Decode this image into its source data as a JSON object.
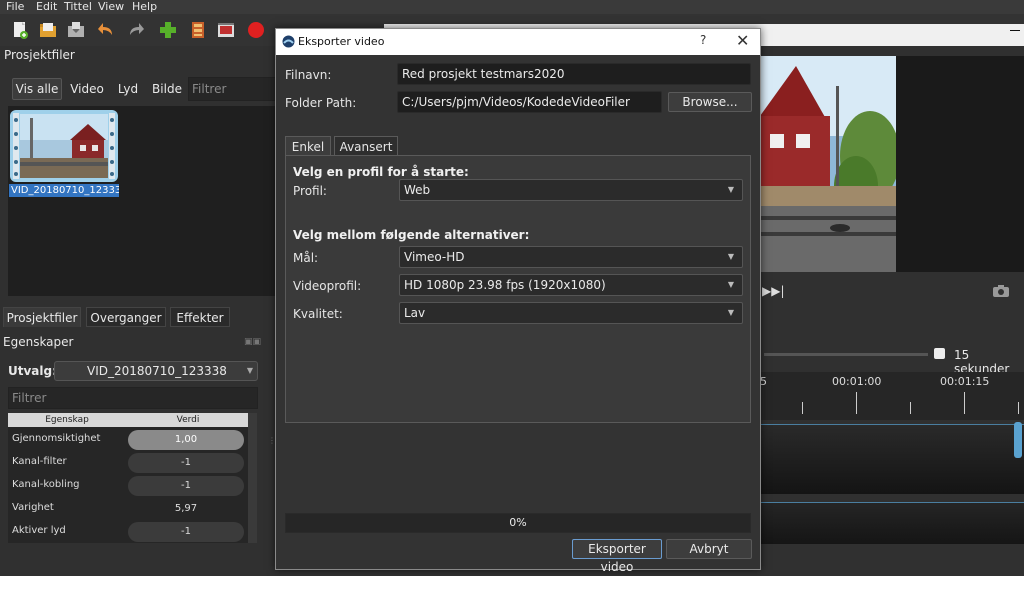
{
  "menu": {
    "items": [
      "File",
      "Edit",
      "Tittel",
      "View",
      "Help"
    ]
  },
  "left_panel": {
    "title": "Prosjektfiler",
    "filters": [
      "Vis alle",
      "Video",
      "Lyd",
      "Bilde"
    ],
    "filter_placeholder": "Filtrer",
    "file_label": "VID_20180710_12333..."
  },
  "bottom_tabs": [
    "Prosjektfiler",
    "Overganger",
    "Effekter"
  ],
  "properties": {
    "title": "Egenskaper",
    "selection_label": "Utvalg:",
    "selection_value": "VID_20180710_123338",
    "filter_placeholder": "Filtrer",
    "columns": [
      "Egenskap",
      "Verdi"
    ],
    "rows": [
      {
        "name": "Gjennomsiktighet",
        "value": "1,00"
      },
      {
        "name": "Kanal-filter",
        "value": "-1"
      },
      {
        "name": "Kanal-kobling",
        "value": "-1"
      },
      {
        "name": "Varighet",
        "value": "5,97"
      },
      {
        "name": "Aktiver lyd",
        "value": "-1"
      }
    ]
  },
  "timeline": {
    "zoom_label": "15 sekunder",
    "marks": [
      "5",
      "00:01:00",
      "00:01:15"
    ]
  },
  "dialog": {
    "title": "Eksporter video",
    "help_label": "?",
    "close_label": "✕",
    "filename_label": "Filnavn:",
    "filename_value": "Red prosjekt testmars2020",
    "folder_label": "Folder Path:",
    "folder_value": "C:/Users/pjm/Videos/KodedeVideoFiler",
    "browse_label": "Browse...",
    "tabs": [
      "Enkel",
      "Avansert"
    ],
    "section1": "Velg en profil for å starte:",
    "profil_label": "Profil:",
    "profil_value": "Web",
    "section2": "Velg mellom følgende alternativer:",
    "maal_label": "Mål:",
    "maal_value": "Vimeo-HD",
    "videoprofil_label": "Videoprofil:",
    "videoprofil_value": "HD 1080p 23.98 fps (1920x1080)",
    "kvalitet_label": "Kvalitet:",
    "kvalitet_value": "Lav",
    "progress_text": "0%",
    "export_label": "Eksporter video",
    "cancel_label": "Avbryt"
  },
  "icons": {
    "toolbar": [
      "new-project-icon",
      "open-project-icon",
      "save-project-icon",
      "undo-icon",
      "redo-icon",
      "import-files-icon",
      "profile-icon",
      "fullscreen-icon",
      "record-icon"
    ],
    "accent": "#3375c2",
    "record_color": "#e02020",
    "import_color": "#57b02a"
  }
}
